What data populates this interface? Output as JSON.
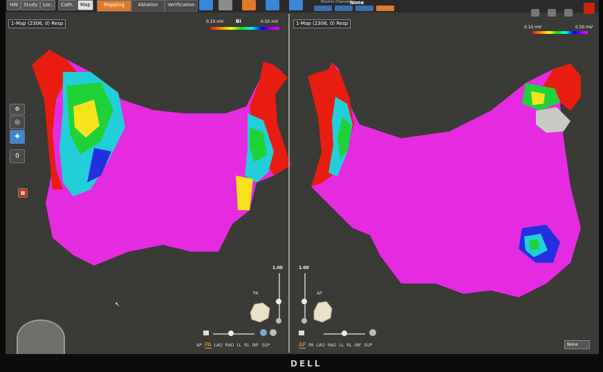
{
  "topbar": {
    "nav_tabs": [
      "HW",
      "Study",
      "Loc.",
      "Cath.",
      "Map"
    ],
    "active_nav": "Map",
    "mode_buttons": [
      "Mapping",
      "Ablation",
      "Verification"
    ],
    "active_mode": "Mapping",
    "view_channel_label": "Rhythm Channel",
    "view_channel_value": "None"
  },
  "left_pane": {
    "map_select": "1-Map (2306, 0) Resp",
    "scale_min": "0.10 mV",
    "scale_type": "Bi",
    "scale_max": "0.50 mV",
    "opacity": "1.00",
    "view_label": "PA",
    "views": [
      "AP",
      "PA",
      "LAO",
      "RAO",
      "LL",
      "RL",
      "INF",
      "SUP"
    ],
    "selected_view": "PA",
    "side_value": "0"
  },
  "right_pane": {
    "map_select": "1-Map (2306, 0) Resp",
    "scale_min": "0.10 mV",
    "scale_max": "0.50 mV",
    "opacity": "1.00",
    "view_label": "AP",
    "views": [
      "AP",
      "PA",
      "LAO",
      "RAO",
      "LL",
      "RL",
      "INF",
      "SUP"
    ],
    "selected_view": "AP",
    "rhythm_select": "None"
  },
  "monitor_brand": "DELL",
  "colors": {
    "screen_bg": "#3a3a36",
    "healthy": "#e52be0",
    "scar": "#e81c10",
    "accent": "#e07a2a"
  }
}
